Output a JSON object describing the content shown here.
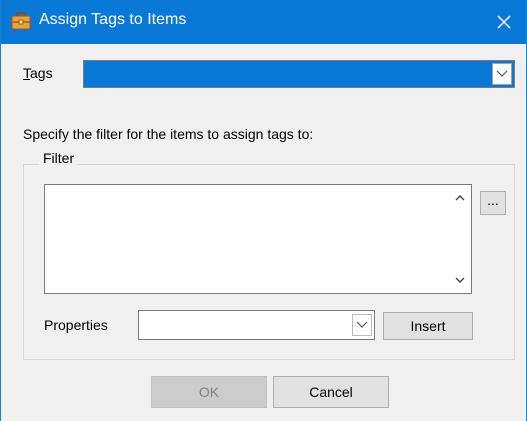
{
  "window": {
    "title": "Assign Tags to Items",
    "title_icon": "toolbox-icon",
    "accent_color": "#0a78d7"
  },
  "tags": {
    "label_access_key": "T",
    "label_rest": "ags",
    "value": ""
  },
  "instruction": "Specify the filter for the items to assign tags to:",
  "filter": {
    "group_label": "Filter",
    "value": "",
    "ellipsis_label": "..."
  },
  "properties": {
    "label": "Properties",
    "value": "",
    "insert_label": "Insert"
  },
  "buttons": {
    "ok_label": "OK",
    "ok_enabled": false,
    "cancel_label": "Cancel"
  }
}
